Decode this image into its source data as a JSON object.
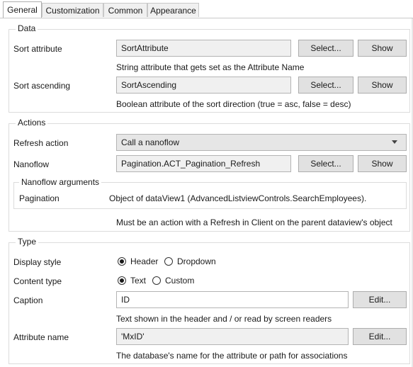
{
  "tabs": [
    {
      "label": "General",
      "active": true
    },
    {
      "label": "Customization",
      "active": false
    },
    {
      "label": "Common",
      "active": false
    },
    {
      "label": "Appearance",
      "active": false
    }
  ],
  "data_group": {
    "title": "Data",
    "sort_attribute": {
      "label": "Sort attribute",
      "value": "SortAttribute",
      "select_label": "Select...",
      "show_label": "Show",
      "hint": "String attribute that gets set as the Attribute Name"
    },
    "sort_ascending": {
      "label": "Sort ascending",
      "value": "SortAscending",
      "select_label": "Select...",
      "show_label": "Show",
      "hint": "Boolean attribute of the sort direction (true = asc, false = desc)"
    }
  },
  "actions_group": {
    "title": "Actions",
    "refresh_action": {
      "label": "Refresh action",
      "value": "Call a nanoflow"
    },
    "nanoflow": {
      "label": "Nanoflow",
      "value": "Pagination.ACT_Pagination_Refresh",
      "select_label": "Select...",
      "show_label": "Show"
    },
    "nanoflow_arguments": {
      "title": "Nanoflow arguments",
      "rows": [
        {
          "name": "Pagination",
          "value": "Object of dataView1 (AdvancedListviewControls.SearchEmployees)."
        }
      ]
    },
    "hint": "Must be an action with a Refresh in Client on the parent dataview's object"
  },
  "type_group": {
    "title": "Type",
    "display_style": {
      "label": "Display style",
      "options": [
        "Header",
        "Dropdown"
      ],
      "selected": "Header"
    },
    "content_type": {
      "label": "Content type",
      "options": [
        "Text",
        "Custom"
      ],
      "selected": "Text"
    },
    "caption": {
      "label": "Caption",
      "value": "ID",
      "edit_label": "Edit...",
      "hint": "Text shown in the header and / or read by screen readers"
    },
    "attribute_name": {
      "label": "Attribute name",
      "value": "'MxID'",
      "edit_label": "Edit...",
      "hint": "The database's name for the attribute or path for associations"
    }
  }
}
